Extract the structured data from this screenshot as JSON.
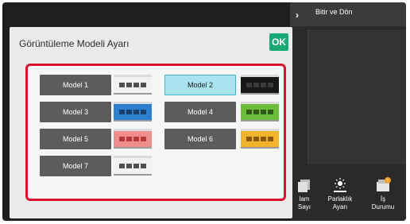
{
  "header": {
    "back_label": "Bitir ve Dön"
  },
  "dialog": {
    "title": "Görüntüleme Modeli Ayarı",
    "ok_label": "OK",
    "models": [
      {
        "label": "Model 1",
        "selected": false,
        "swatch_bg": "#f2f2f2",
        "swatch_fg": "#505050"
      },
      {
        "label": "Model 2",
        "selected": true,
        "swatch_bg": "#181818",
        "swatch_fg": "#3a3a3a"
      },
      {
        "label": "Model 3",
        "selected": false,
        "swatch_bg": "#2f7fd0",
        "swatch_fg": "#1a3f6b"
      },
      {
        "label": "Model 4",
        "selected": false,
        "swatch_bg": "#6bbd3b",
        "swatch_fg": "#2f5a16"
      },
      {
        "label": "Model 5",
        "selected": false,
        "swatch_bg": "#f08e8e",
        "swatch_fg": "#b63a3a"
      },
      {
        "label": "Model 6",
        "selected": false,
        "swatch_bg": "#f0b52a",
        "swatch_fg": "#8a5a06"
      },
      {
        "label": "Model 7",
        "selected": false,
        "swatch_bg": "#f2f2f2",
        "swatch_fg": "#505050"
      }
    ]
  },
  "toolbar": {
    "item1_label_1": "lam",
    "item1_label_2": "Sayı",
    "item2_label_1": "Parlaklık",
    "item2_label_2": "Ayarı",
    "item3_label_1": "İş",
    "item3_label_2": "Durumu"
  },
  "colors": {
    "highlight_frame": "#d8122a",
    "ok_green": "#19a974",
    "selected_bg": "#a9e3ee"
  }
}
